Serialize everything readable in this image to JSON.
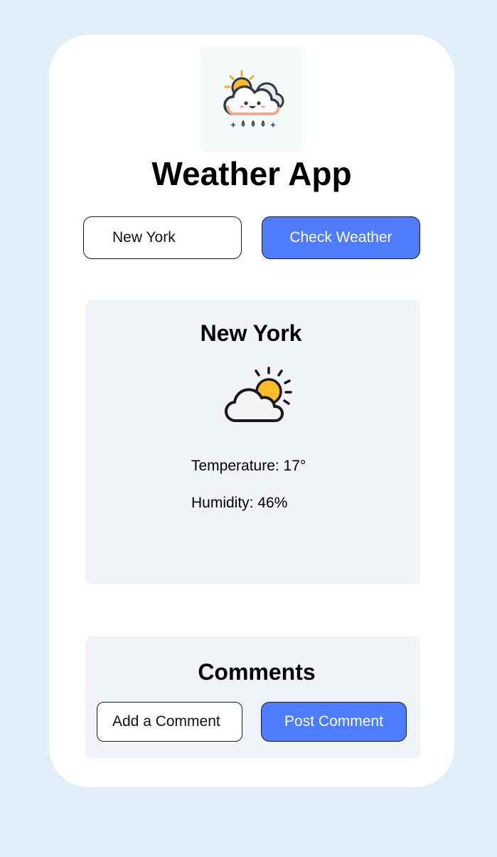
{
  "app": {
    "title": "Weather App",
    "logo_icon": "smiling-cloud-sun-rain-icon"
  },
  "search": {
    "value": "New York",
    "button_label": "Check Weather"
  },
  "weather": {
    "city": "New York",
    "condition_icon": "partly-cloudy-icon",
    "temperature": "Temperature: 17°",
    "humidity": "Humidity: 46%"
  },
  "comments": {
    "title": "Comments",
    "placeholder": "Add a Comment",
    "post_label": "Post Comment"
  },
  "colors": {
    "page_background": "#e2effb",
    "card_background": "#ffffff",
    "panel_background": "#f0f3f8",
    "accent": "#4d7cfe",
    "sun": "#fbbd27"
  }
}
